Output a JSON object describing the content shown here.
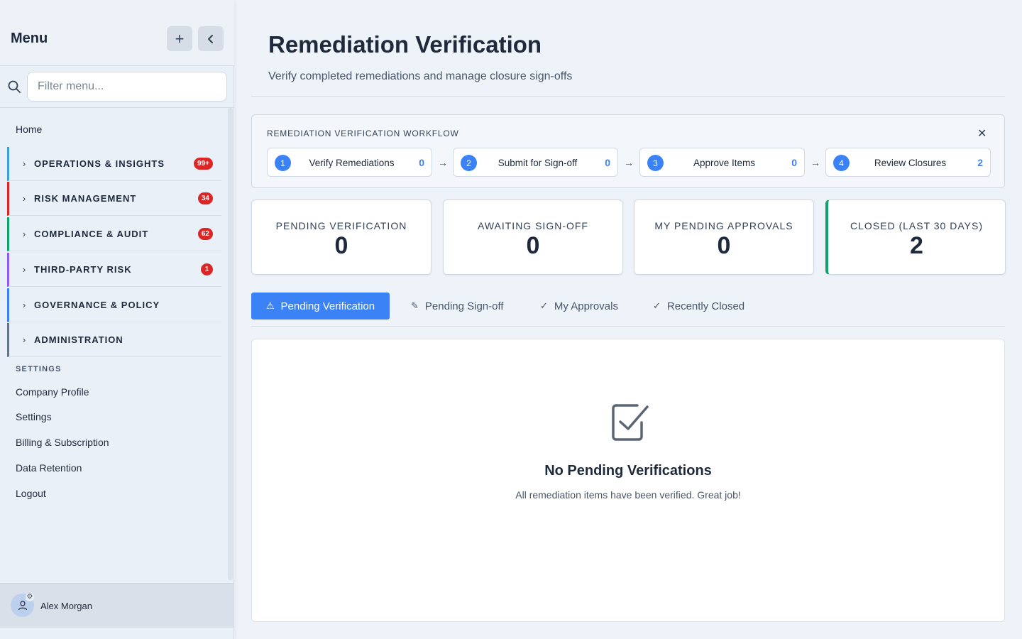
{
  "sidebar": {
    "title": "Menu",
    "add_icon": "plus-icon",
    "collapse_icon": "chevron-left-icon",
    "search": {
      "placeholder": "Filter menu...",
      "icon": "search-icon"
    },
    "home_label": "Home",
    "groups": [
      {
        "label": "OPERATIONS & INSIGHTS",
        "badge": "99+",
        "color": "#3b9fd9"
      },
      {
        "label": "RISK MANAGEMENT",
        "badge": "34",
        "color": "#dc2626"
      },
      {
        "label": "COMPLIANCE & AUDIT",
        "badge": "62",
        "color": "#10a36a"
      },
      {
        "label": "THIRD-PARTY RISK",
        "badge": "1",
        "color": "#8b5cf6"
      },
      {
        "label": "GOVERNANCE & POLICY",
        "badge": "",
        "color": "#3b82f6"
      },
      {
        "label": "ADMINISTRATION",
        "badge": "",
        "color": "#64748b"
      }
    ],
    "settings_header": "SETTINGS",
    "settings_items": [
      "Company Profile",
      "Settings",
      "Billing & Subscription",
      "Data Retention",
      "Logout"
    ],
    "user": {
      "name": "Alex Morgan",
      "avatar_icon": "user-icon"
    }
  },
  "page": {
    "title": "Remediation Verification",
    "subtitle": "Verify completed remediations and manage closure sign-offs"
  },
  "workflow": {
    "title": "REMEDIATION VERIFICATION WORKFLOW",
    "close_icon": "close-icon",
    "steps": [
      {
        "num": "1",
        "label": "Verify Remediations",
        "count": "0"
      },
      {
        "num": "2",
        "label": "Submit for Sign-off",
        "count": "0"
      },
      {
        "num": "3",
        "label": "Approve Items",
        "count": "0"
      },
      {
        "num": "4",
        "label": "Review Closures",
        "count": "2"
      }
    ],
    "arrow": "→"
  },
  "stats": [
    {
      "label": "PENDING VERIFICATION",
      "value": "0"
    },
    {
      "label": "AWAITING SIGN-OFF",
      "value": "0"
    },
    {
      "label": "MY PENDING APPROVALS",
      "value": "0"
    },
    {
      "label": "CLOSED (LAST 30 DAYS)",
      "value": "2"
    }
  ],
  "tabs": [
    {
      "label": "Pending Verification",
      "icon": "⚠",
      "active": true
    },
    {
      "label": "Pending Sign-off",
      "icon": "✎",
      "active": false
    },
    {
      "label": "My Approvals",
      "icon": "✓",
      "active": false
    },
    {
      "label": "Recently Closed",
      "icon": "✓",
      "active": false
    }
  ],
  "empty_state": {
    "icon": "checkbox-checked-icon",
    "title": "No Pending Verifications",
    "text": "All remediation items have been verified. Great job!"
  },
  "colors": {
    "accent": "#3b82f6",
    "badge": "#dc2626",
    "closed_accent": "#10a36a"
  }
}
